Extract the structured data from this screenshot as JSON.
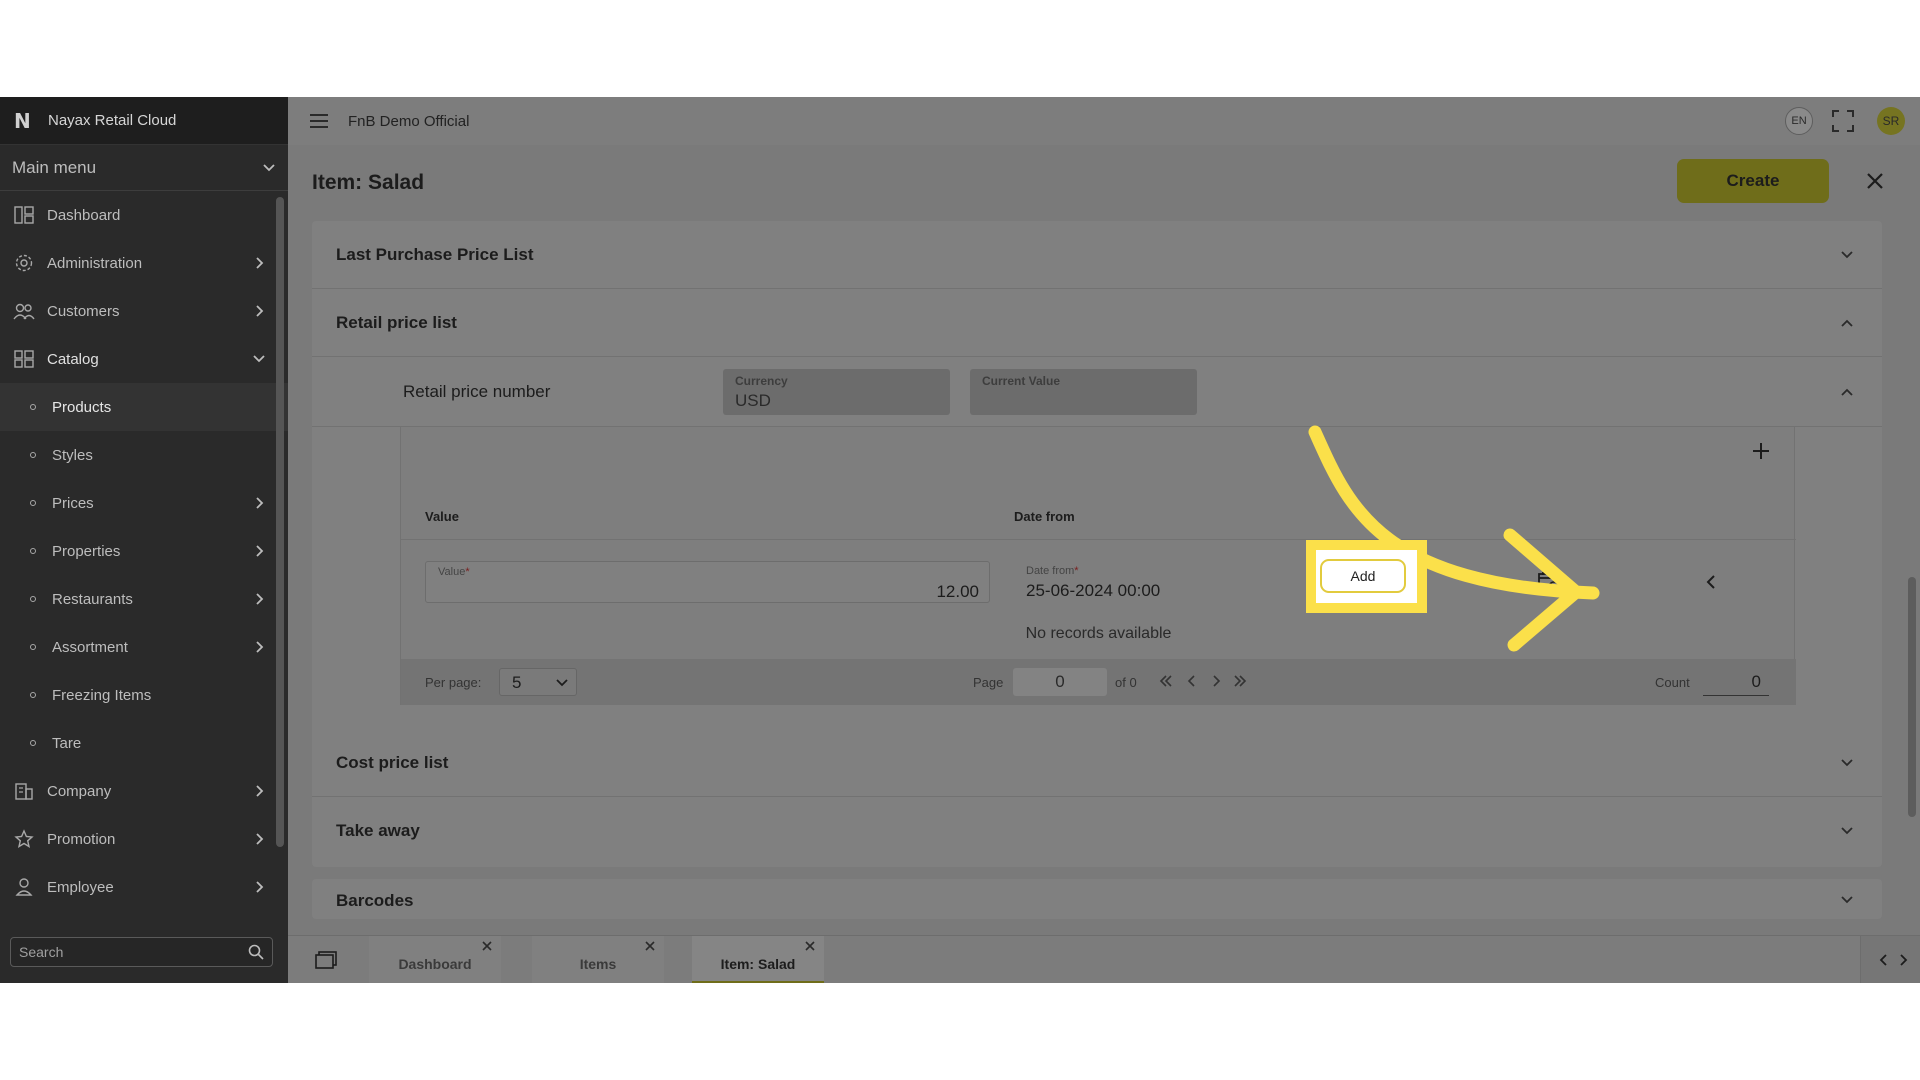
{
  "app": {
    "name": "Nayax Retail Cloud",
    "tenant": "FnB Demo Official"
  },
  "sidebar": {
    "menu_title": "Main menu",
    "items": [
      {
        "label": "Dashboard",
        "icon": "dashboard-icon"
      },
      {
        "label": "Administration",
        "icon": "admin-gear-icon"
      },
      {
        "label": "Customers",
        "icon": "customers-icon"
      },
      {
        "label": "Catalog",
        "icon": "catalog-icon"
      },
      {
        "label": "Products"
      },
      {
        "label": "Styles"
      },
      {
        "label": "Prices"
      },
      {
        "label": "Properties"
      },
      {
        "label": "Restaurants"
      },
      {
        "label": "Assortment"
      },
      {
        "label": "Freezing Items"
      },
      {
        "label": "Tare"
      },
      {
        "label": "Company",
        "icon": "company-icon"
      },
      {
        "label": "Promotion",
        "icon": "star-icon"
      },
      {
        "label": "Employee",
        "icon": "employee-icon"
      }
    ],
    "search_placeholder": "Search"
  },
  "topbar": {
    "lang": "EN",
    "avatar": "SR"
  },
  "page": {
    "title": "Item: Salad",
    "create_label": "Create",
    "sections": {
      "last_purchase": "Last Purchase Price List",
      "retail": "Retail price list",
      "cost": "Cost price list",
      "takeaway": "Take away",
      "barcodes": "Barcodes"
    },
    "retail_row": {
      "label": "Retail price number",
      "currency_label": "Currency",
      "currency_value": "USD",
      "current_value_label": "Current Value",
      "current_value": ""
    },
    "table": {
      "col_value": "Value",
      "col_date": "Date from",
      "value_field_label": "Value",
      "value_field_value": "12.00",
      "date_field_label": "Date from",
      "date_field_value": "25-06-2024 00:00",
      "required_mark": "*",
      "add_label": "Add",
      "no_records": "No records available"
    },
    "pager": {
      "per_page_label": "Per page:",
      "per_page_value": "5",
      "page_label": "Page",
      "page_value": "0",
      "of_label": "of 0",
      "count_label": "Count",
      "count_value": "0"
    }
  },
  "footer": {
    "tabs": [
      {
        "label": "Dashboard"
      },
      {
        "label": "Items"
      },
      {
        "label": "Item: Salad"
      }
    ]
  },
  "colors": {
    "highlight": "#fbe04a",
    "brand_olive": "#6f6d1a",
    "overlay_gray": "#7a7a7a",
    "sidebar_dark": "#2a2a2a"
  }
}
